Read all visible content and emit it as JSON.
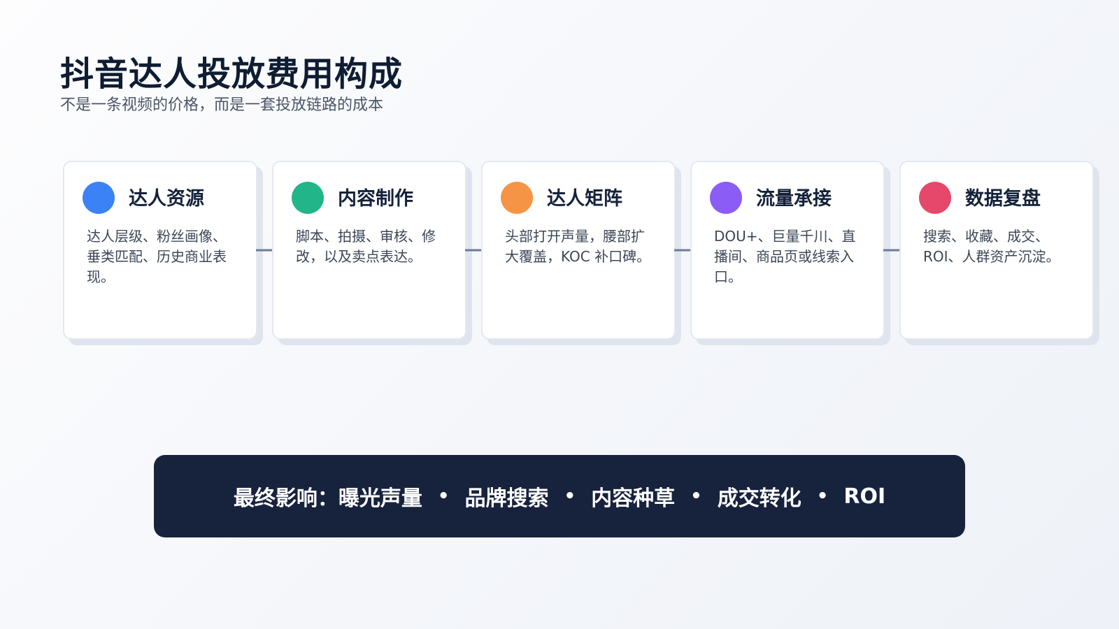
{
  "header": {
    "title": "抖音达人投放费用构成",
    "subtitle": "不是一条视频的价格，而是一套投放链路的成本"
  },
  "steps": [
    {
      "title": "达人资源",
      "desc": "达人层级、粉丝画像、垂类匹配、历史商业表现。",
      "color": "#3b82f6"
    },
    {
      "title": "内容制作",
      "desc": "脚本、拍摄、审核、修改，以及卖点表达。",
      "color": "#22b58a"
    },
    {
      "title": "达人矩阵",
      "desc": "头部打开声量，腰部扩大覆盖，KOC 补口碑。",
      "color": "#f59445"
    },
    {
      "title": "流量承接",
      "desc": "DOU+、巨量千川、直播间、商品页或线索入口。",
      "color": "#8b5cf6"
    },
    {
      "title": "数据复盘",
      "desc": "搜索、收藏、成交、ROI、人群资产沉淀。",
      "color": "#e5486b"
    }
  ],
  "banner": {
    "prefix": "最终影响：",
    "items": [
      "曝光声量",
      "品牌搜索",
      "内容种草",
      "成交转化",
      "ROI"
    ],
    "separator": "•"
  },
  "colors": {
    "banner_bg": "#17223d",
    "arrow": "#6b7a99"
  }
}
